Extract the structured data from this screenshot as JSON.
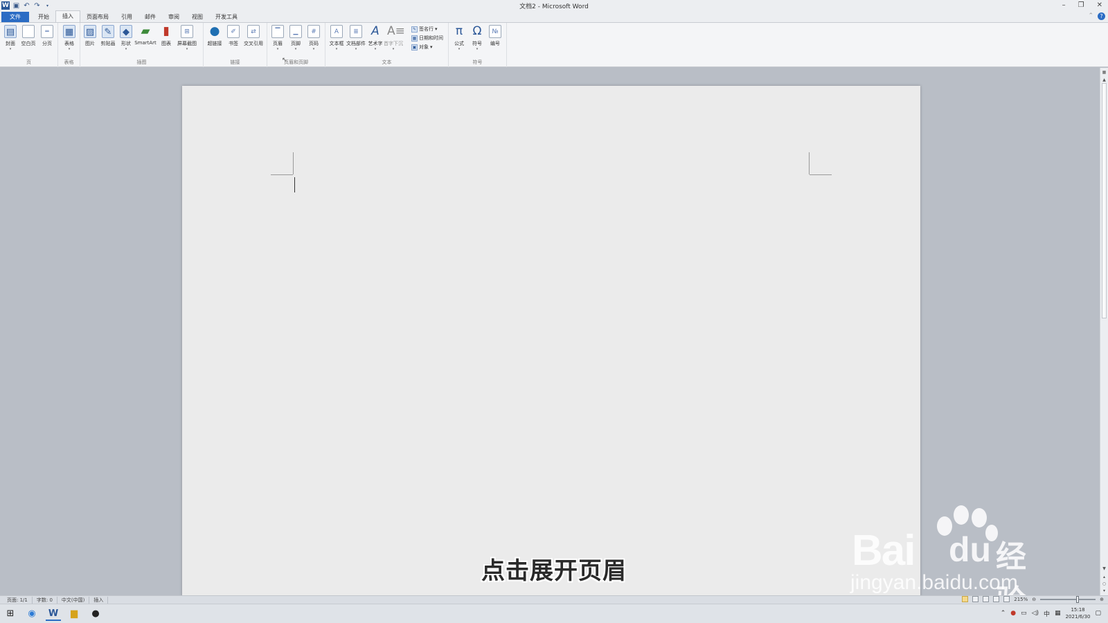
{
  "window": {
    "title": "文档2 - Microsoft Word"
  },
  "tabs": {
    "file": "文件",
    "items": [
      "开始",
      "插入",
      "页面布局",
      "引用",
      "邮件",
      "审阅",
      "视图",
      "开发工具"
    ],
    "active": "插入"
  },
  "ribbon": {
    "groups": {
      "pages": {
        "label": "页",
        "buttons": [
          "封面",
          "空白页",
          "分页"
        ]
      },
      "tables": {
        "label": "表格",
        "buttons": [
          "表格"
        ]
      },
      "illustrations": {
        "label": "插图",
        "buttons": [
          "图片",
          "剪贴画",
          "形状",
          "SmartArt",
          "图表",
          "屏幕截图"
        ]
      },
      "links": {
        "label": "链接",
        "buttons": [
          "超链接",
          "书签",
          "交叉引用"
        ]
      },
      "header_footer": {
        "label": "页眉和页脚",
        "buttons": [
          "页眉",
          "页脚",
          "页码"
        ]
      },
      "text": {
        "label": "文本",
        "buttons": [
          "文本框",
          "文档部件",
          "艺术字",
          "首字下沉"
        ],
        "small": [
          "签名行",
          "日期和时间",
          "对象"
        ]
      },
      "symbols": {
        "label": "符号",
        "buttons": [
          "公式",
          "符号",
          "编号"
        ]
      }
    }
  },
  "caption": "点击展开页眉",
  "watermark": {
    "bai": "Bai",
    "du": "du",
    "cn": "经验",
    "url": "jingyan.baidu.com"
  },
  "statusbar": {
    "page": "页面: 1/1",
    "words": "字数: 0",
    "language": "中文(中国)",
    "mode": "插入",
    "zoom": "215%"
  },
  "taskbar": {
    "ime": "中",
    "time": "15:18",
    "date": "2021/6/30"
  },
  "colors": {
    "accent": "#2b6cc4",
    "workspace": "#b9bec6",
    "page": "#ebebeb"
  }
}
